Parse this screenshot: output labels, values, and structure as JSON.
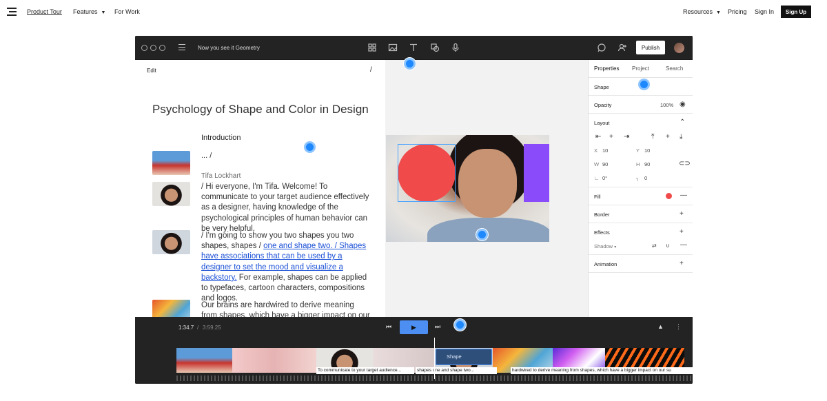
{
  "site": {
    "nav": {
      "product_tour": "Product Tour",
      "features": "Features",
      "for_work": "For Work",
      "resources": "Resources",
      "pricing": "Pricing",
      "sign_in": "Sign In",
      "sign_up": "Sign Up"
    }
  },
  "app": {
    "doc_title": "Now you see it Geometry",
    "publish": "Publish",
    "editor": {
      "edit_label": "Edit",
      "slash": "/",
      "heading": "Psychology of Shape and Color in Design",
      "section": "Introduction",
      "ellipsis": "... /",
      "speaker": "Tifa Lockhart",
      "para1": "/ Hi everyone, I'm Tifa. Welcome! To communicate to your target audience effectively as a designer, having knowledge of the psychological principles of human behavior can be very helpful.",
      "para2_a": "/ I'm going to show you two shapes you two shapes, shapes / ",
      "para2_b": "one and shape two. / Shapes have associations that can be used by a designer to set the mood and visualize a backstory.",
      "para2_c": " For example, shapes can be applied to typefaces, cartoon characters, compositions and logos.",
      "para3": "Our brains are hardwired to derive meaning from shapes, which have a bigger impact on our"
    },
    "properties": {
      "tabs": [
        "Properties",
        "Project",
        "Search"
      ],
      "shape": "Shape",
      "opacity_label": "Opacity",
      "opacity_value": "100%",
      "layout": "Layout",
      "x_label": "X",
      "x_value": "10",
      "y_label": "Y",
      "y_value": "10",
      "w_label": "W",
      "w_value": "90",
      "h_label": "H",
      "h_value": "90",
      "rotation_value": "0°",
      "radius_value": "0",
      "fill": "Fill",
      "fill_color": "#f04a4a",
      "border": "Border",
      "effects": "Effects",
      "shadow": "Shadow",
      "animation": "Animation"
    },
    "playback": {
      "current_time": "1:34.7",
      "separator": "/",
      "total_time": "3:59.25"
    },
    "timeline": {
      "shape_track": "Shape",
      "captions": [
        "To communicate to your target audience...",
        "shapes one and shape two...",
        "hardwired to derive meaning from shapes, which have a bigger impact on our su"
      ]
    },
    "colors": {
      "accent": "#4c8ef2",
      "circle": "#f04a4a",
      "square": "#8a4cfb",
      "marker": "#1e88ff"
    }
  }
}
